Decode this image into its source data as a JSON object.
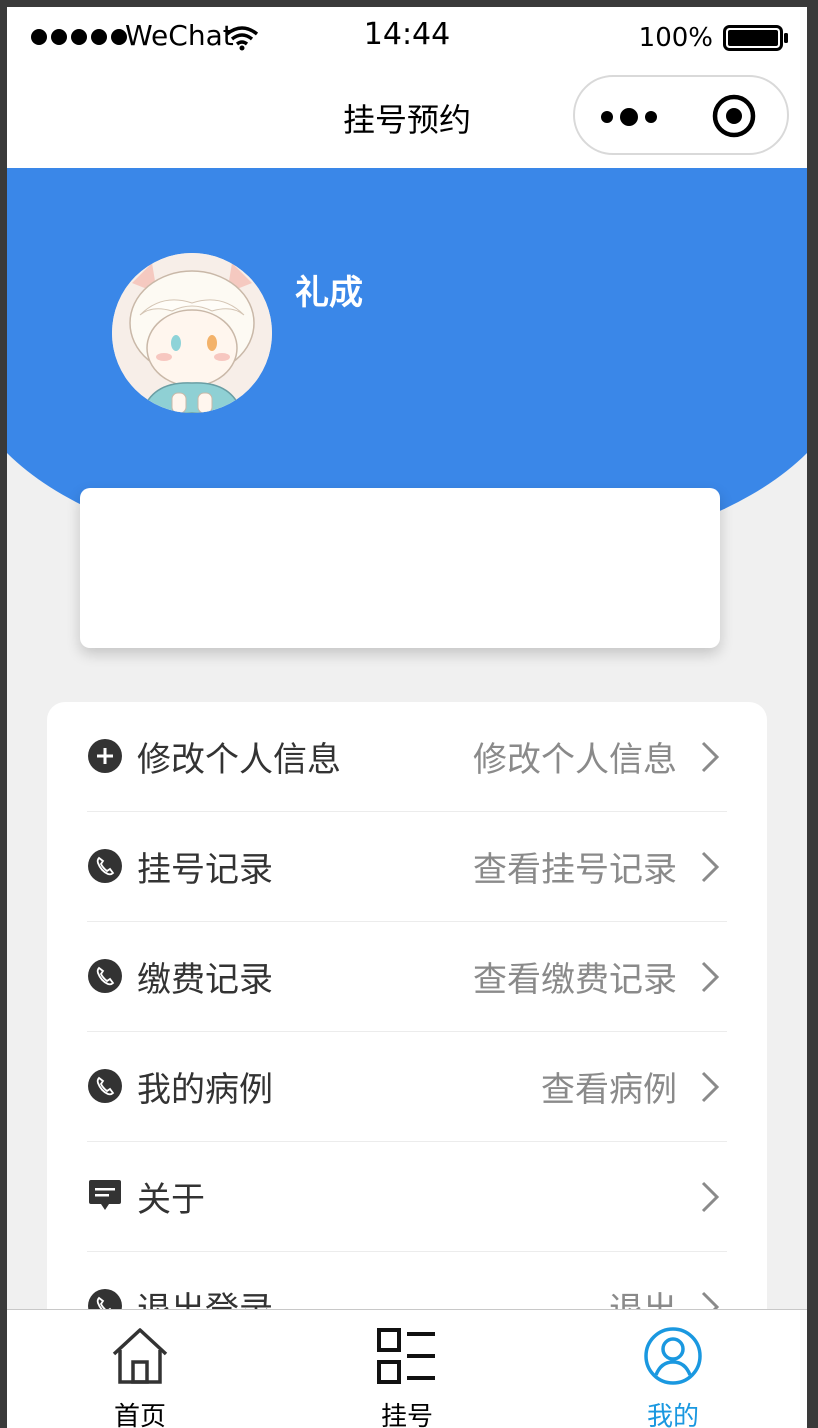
{
  "status_bar": {
    "carrier": "WeChat",
    "time": "14:44",
    "battery": "100%"
  },
  "nav": {
    "title": "挂号预约"
  },
  "profile": {
    "name": "礼成"
  },
  "menu": {
    "items": [
      {
        "icon": "plus-circle-icon",
        "label": "修改个人信息",
        "value": "修改个人信息"
      },
      {
        "icon": "phone-icon",
        "label": "挂号记录",
        "value": "查看挂号记录"
      },
      {
        "icon": "phone-icon",
        "label": "缴费记录",
        "value": "查看缴费记录"
      },
      {
        "icon": "phone-icon",
        "label": "我的病例",
        "value": "查看病例"
      },
      {
        "icon": "message-icon",
        "label": "关于",
        "value": ""
      },
      {
        "icon": "phone-icon",
        "label": "退出登录",
        "value": "退出"
      }
    ]
  },
  "tabs": [
    {
      "icon": "home-icon",
      "label": "首页",
      "active": false
    },
    {
      "icon": "list-icon",
      "label": "挂号",
      "active": false
    },
    {
      "icon": "user-icon",
      "label": "我的",
      "active": true
    }
  ],
  "colors": {
    "header_blue": "#3a87e8",
    "tab_active": "#1a98e0"
  }
}
